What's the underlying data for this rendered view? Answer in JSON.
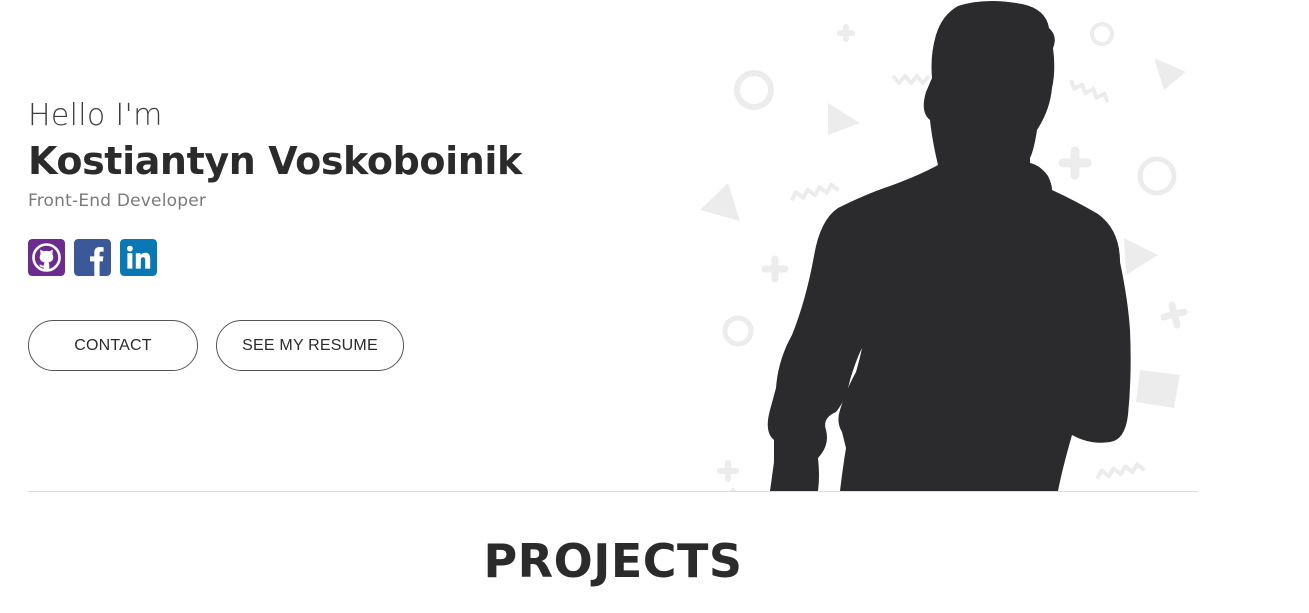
{
  "hero": {
    "greeting": "Hello I'm",
    "name": "Kostiantyn Voskoboinik",
    "role": "Front-End Developer",
    "social": [
      {
        "icon": "github-icon",
        "color": "#6e2b8f"
      },
      {
        "icon": "facebook-icon",
        "color": "#3b5998"
      },
      {
        "icon": "linkedin-icon",
        "color": "#0a78b5"
      }
    ],
    "buttons": {
      "contact": "CONTACT",
      "resume": "SEE MY RESUME"
    },
    "illustration": {
      "subject": "person-silhouette",
      "silhouette_color": "#2b2b2d",
      "shape_color": "#ececec"
    }
  },
  "projects": {
    "title": "PROJECTS"
  }
}
